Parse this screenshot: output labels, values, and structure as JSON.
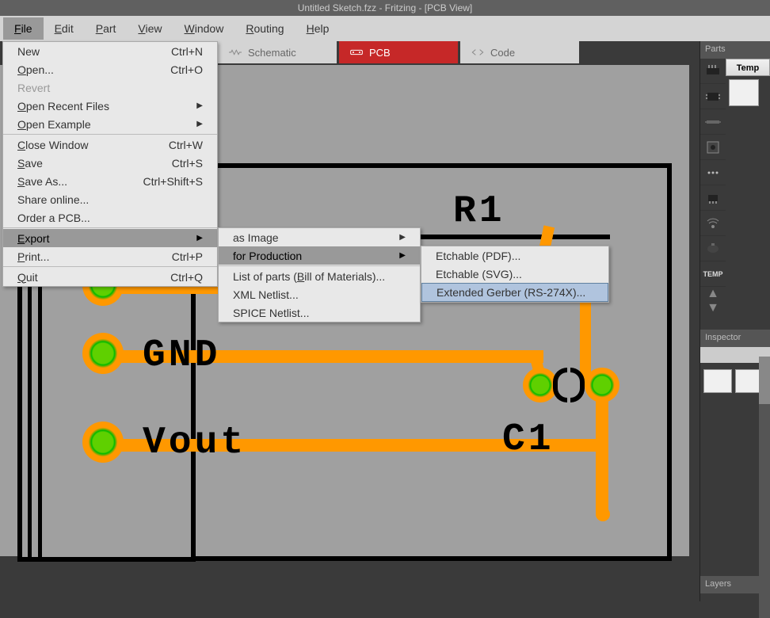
{
  "title": "Untitled Sketch.fzz - Fritzing - [PCB View]",
  "menubar": [
    "File",
    "Edit",
    "Part",
    "View",
    "Window",
    "Routing",
    "Help"
  ],
  "viewtabs": {
    "schematic": "Schematic",
    "pcb": "PCB",
    "code": "Code"
  },
  "file_menu": {
    "new": {
      "label": "New",
      "accel": "Ctrl+N"
    },
    "open": {
      "label": "Open...",
      "accel": "Ctrl+O"
    },
    "revert": {
      "label": "Revert"
    },
    "recent": {
      "label": "Open Recent Files"
    },
    "example": {
      "label": "Open Example"
    },
    "close": {
      "label": "Close Window",
      "accel": "Ctrl+W"
    },
    "save": {
      "label": "Save",
      "accel": "Ctrl+S"
    },
    "saveas": {
      "label": "Save As...",
      "accel": "Ctrl+Shift+S"
    },
    "share": {
      "label": "Share online..."
    },
    "order": {
      "label": "Order a PCB..."
    },
    "export": {
      "label": "Export"
    },
    "print": {
      "label": "Print...",
      "accel": "Ctrl+P"
    },
    "quit": {
      "label": "Quit",
      "accel": "Ctrl+Q"
    }
  },
  "export_submenu": {
    "as_image": "as Image",
    "for_production": "for Production",
    "bom": "List of parts (Bill of Materials)...",
    "xml": "XML Netlist...",
    "spice": "SPICE Netlist..."
  },
  "production_submenu": {
    "etch_pdf": "Etchable (PDF)...",
    "etch_svg": "Etchable (SVG)...",
    "gerber": "Extended Gerber (RS-274X)..."
  },
  "canvas_labels": {
    "r1": "R1",
    "gnd": "GND",
    "vout": "Vout",
    "c1": "C1"
  },
  "right_panel": {
    "parts_header": "Parts",
    "temp_label": "Temp",
    "temp_icon": "TEMP",
    "inspector_header": "Inspector",
    "layers_header": "Layers"
  },
  "colors": {
    "trace": "#ff9800",
    "pad_inner": "#5fd000",
    "active_tab": "#c62828"
  }
}
